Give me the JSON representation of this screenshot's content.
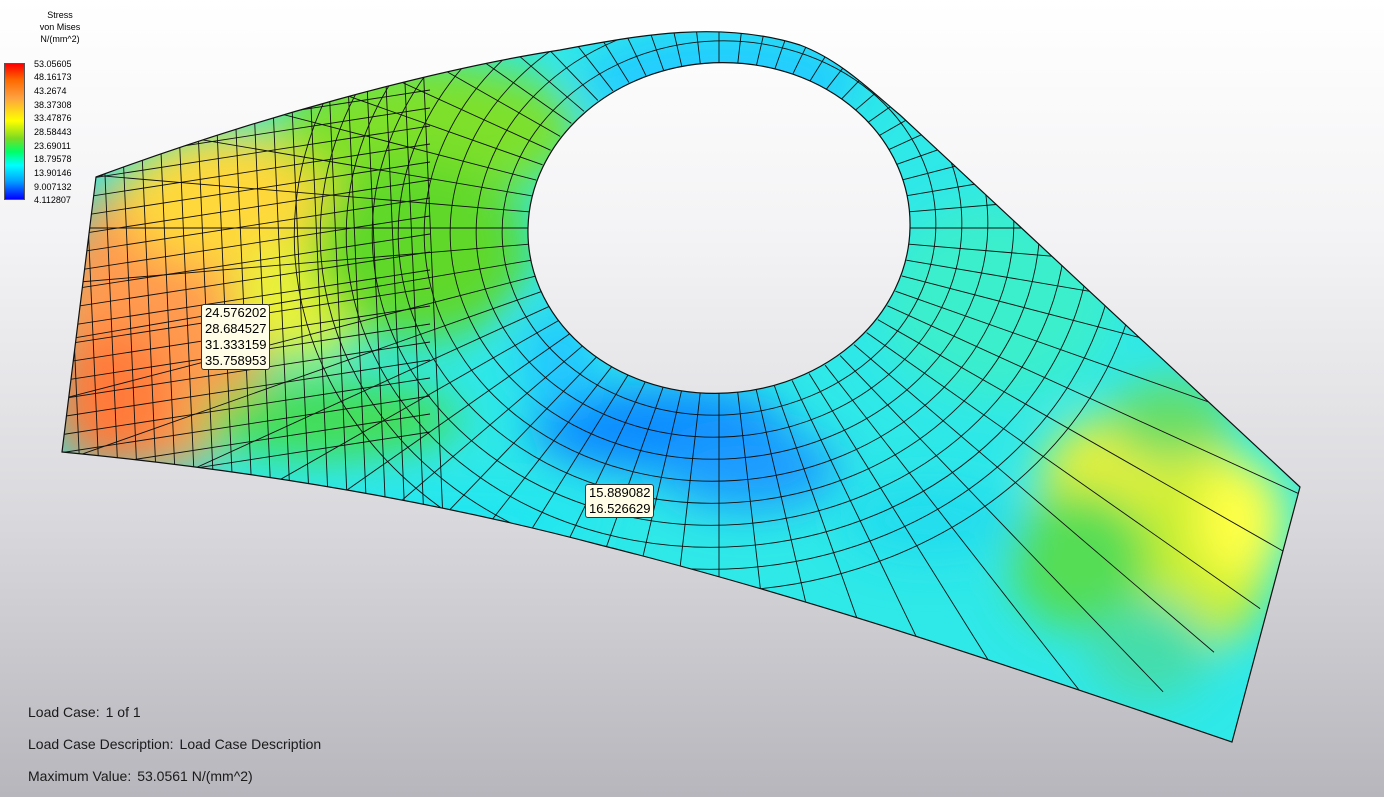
{
  "legend": {
    "title_lines": [
      "Stress",
      "von Mises",
      "N/(mm^2)"
    ],
    "values": [
      "53.05605",
      "48.16173",
      "43.2674",
      "38.37308",
      "33.47876",
      "28.58443",
      "23.69011",
      "18.79578",
      "13.90146",
      "9.007132",
      "4.112807"
    ]
  },
  "probes": [
    {
      "values": [
        "24.576202",
        "28.684527",
        "31.333159",
        "35.758953"
      ]
    },
    {
      "values": [
        "15.889082",
        "16.526629"
      ]
    }
  ],
  "info": {
    "load_case_label": "Load Case:",
    "load_case_value": "1 of 1",
    "description_label": "Load Case Description:",
    "description_value": "Load Case Description",
    "max_label": "Maximum Value:",
    "max_value": "53.0561 N/(mm^2)"
  },
  "colors": {
    "mesh_line": "#111111",
    "stress_high": "#ff0000",
    "stress_low": "#0000ff"
  }
}
